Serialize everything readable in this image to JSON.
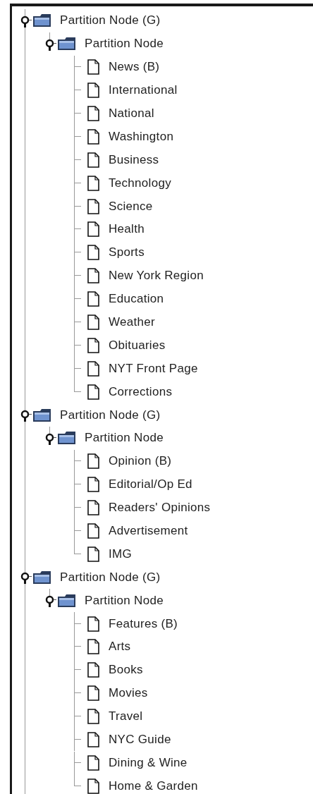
{
  "tree": [
    {
      "label": "Partition Node (G)",
      "expanded": true,
      "children": [
        {
          "label": "Partition Node",
          "expanded": true,
          "children": [
            {
              "label": "News (B)"
            },
            {
              "label": "International"
            },
            {
              "label": "National"
            },
            {
              "label": "Washington"
            },
            {
              "label": "Business"
            },
            {
              "label": "Technology"
            },
            {
              "label": "Science"
            },
            {
              "label": "Health"
            },
            {
              "label": "Sports"
            },
            {
              "label": "New York Region"
            },
            {
              "label": "Education"
            },
            {
              "label": "Weather"
            },
            {
              "label": "Obituaries"
            },
            {
              "label": "NYT Front Page"
            },
            {
              "label": "Corrections"
            }
          ]
        }
      ]
    },
    {
      "label": "Partition Node (G)",
      "expanded": true,
      "children": [
        {
          "label": "Partition Node",
          "expanded": true,
          "children": [
            {
              "label": "Opinion (B)"
            },
            {
              "label": "Editorial/Op Ed"
            },
            {
              "label": "Readers' Opinions"
            },
            {
              "label": "Advertisement"
            },
            {
              "label": "IMG"
            }
          ]
        }
      ]
    },
    {
      "label": "Partition Node (G)",
      "expanded": true,
      "children": [
        {
          "label": "Partition Node",
          "expanded": true,
          "children": [
            {
              "label": "Features (B)"
            },
            {
              "label": "Arts"
            },
            {
              "label": "Books"
            },
            {
              "label": "Movies"
            },
            {
              "label": "Travel"
            },
            {
              "label": "NYC Guide"
            },
            {
              "label": "Dining & Wine"
            },
            {
              "label": "Home & Garden"
            }
          ]
        }
      ]
    }
  ]
}
